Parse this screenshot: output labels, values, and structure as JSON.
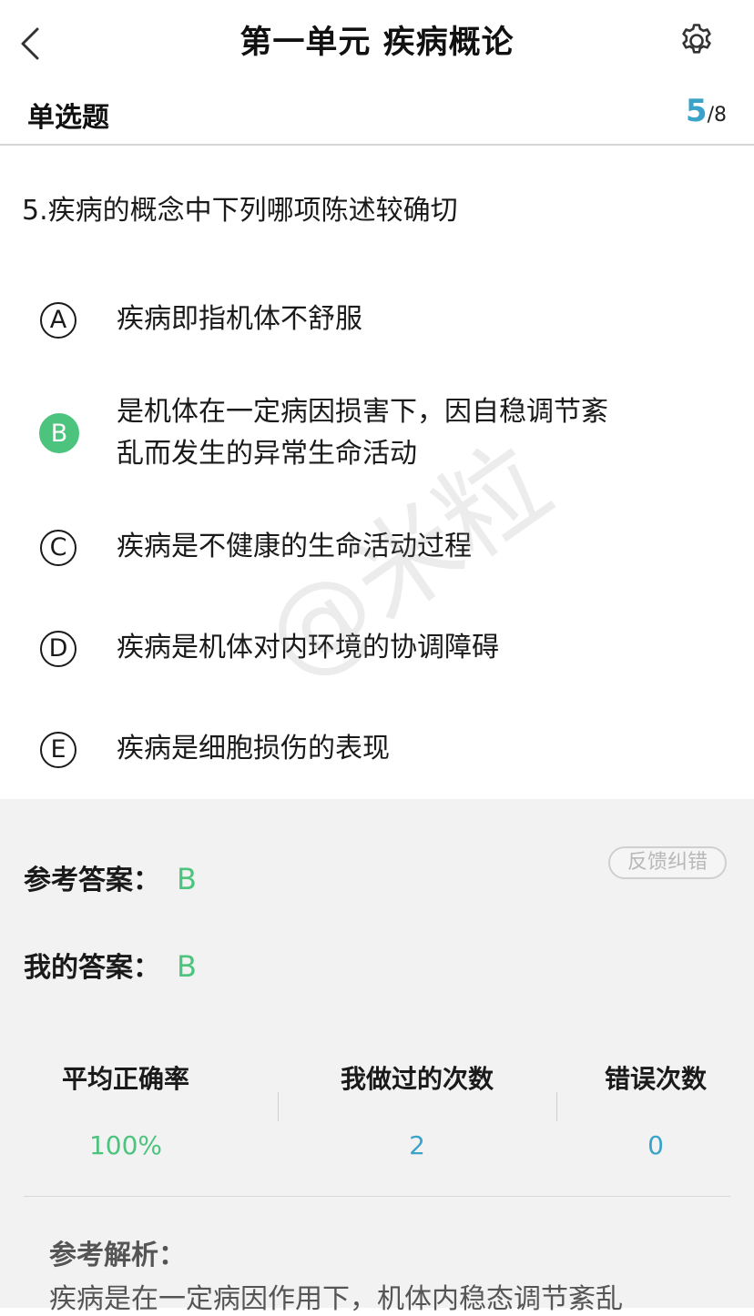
{
  "header": {
    "title": "第一单元 疾病概论",
    "back_icon": "chevron-left-icon",
    "settings_icon": "gear-icon"
  },
  "question_meta": {
    "type_label": "单选题",
    "current": "5",
    "separator": "/",
    "total": "8"
  },
  "question": {
    "text": "5.疾病的概念中下列哪项陈述较确切",
    "options": [
      {
        "letter": "A",
        "lines": [
          "疾病即指机体不舒服"
        ],
        "selected": false
      },
      {
        "letter": "B",
        "lines": [
          "是机体在一定病因损害下，因自稳调节紊",
          "乱而发生的异常生命活动"
        ],
        "selected": true
      },
      {
        "letter": "C",
        "lines": [
          "疾病是不健康的生命活动过程"
        ],
        "selected": false
      },
      {
        "letter": "D",
        "lines": [
          "疾病是机体对内环境的协调障碍"
        ],
        "selected": false
      },
      {
        "letter": "E",
        "lines": [
          "疾病是细胞损伤的表现"
        ],
        "selected": false
      }
    ]
  },
  "watermark": "@米粒",
  "answer": {
    "reference_label": "参考答案：",
    "reference_value": "B",
    "mine_label": "我的答案：",
    "mine_value": "B",
    "feedback_label": "反馈纠错"
  },
  "stats": [
    {
      "label": "平均正确率",
      "value": "100%",
      "color": "#4cc47e"
    },
    {
      "label": "我做过的次数",
      "value": "2",
      "color": "#3aa3c9"
    },
    {
      "label": "错误次数",
      "value": "0",
      "color": "#3aa3c9"
    }
  ],
  "analysis": {
    "title": "参考解析：",
    "text": "疾病是在一定病因作用下，机体内稳态调节紊乱"
  },
  "colors": {
    "accent_green": "#4cc47e",
    "accent_blue": "#3aa3c9",
    "panel_bg": "#f2f2f2"
  }
}
